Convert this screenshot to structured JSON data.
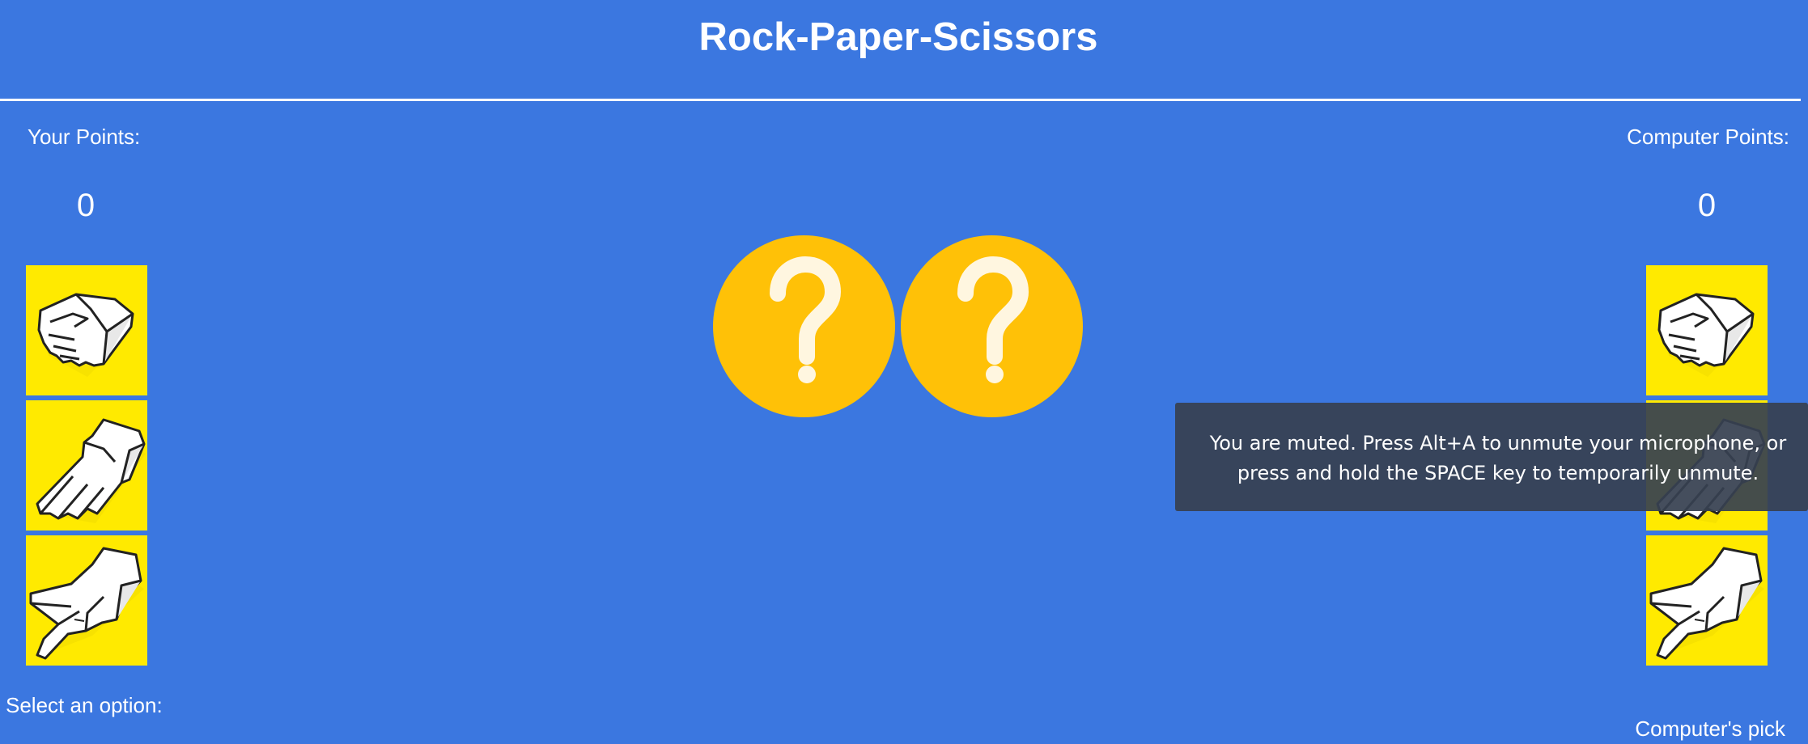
{
  "header": {
    "title": "Rock-Paper-Scissors"
  },
  "player": {
    "points_label": "Your Points:",
    "score": "0",
    "select_label": "Select an option:",
    "options": [
      {
        "name": "rock",
        "icon": "fist-hand-icon"
      },
      {
        "name": "paper",
        "icon": "open-hand-icon"
      },
      {
        "name": "scissors",
        "icon": "scissors-hand-icon"
      }
    ]
  },
  "computer": {
    "points_label": "Computer Points:",
    "score": "0",
    "pick_label": "Computer's pick",
    "options": [
      {
        "name": "rock",
        "icon": "fist-hand-icon"
      },
      {
        "name": "paper",
        "icon": "open-hand-icon"
      },
      {
        "name": "scissors",
        "icon": "scissors-hand-icon"
      }
    ]
  },
  "arena": {
    "player_choice": "?",
    "computer_choice": "?"
  },
  "notification": {
    "text": "You are muted. Press Alt+A to unmute your microphone, or press and hold the SPACE key to temporarily unmute."
  },
  "colors": {
    "background": "#3b77e0",
    "option_tile": "#ffea00",
    "choice_circle": "#ffc107",
    "toast": "#374151"
  }
}
